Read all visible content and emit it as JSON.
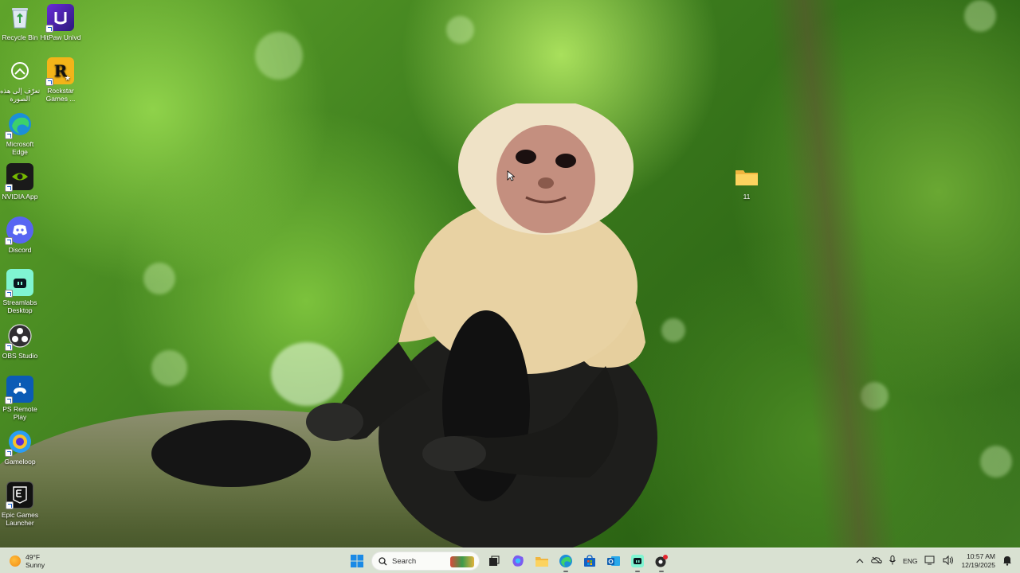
{
  "desktop": {
    "icons": [
      {
        "label": "Recycle Bin",
        "icon": "recycle-bin-icon"
      },
      {
        "label": "HitPaw Univd",
        "icon": "hitpaw-icon"
      },
      {
        "label": "تعرّف إلى هذه الصورة",
        "icon": "learn-about-picture-icon"
      },
      {
        "label": "Rockstar Games ...",
        "icon": "rockstar-icon"
      },
      {
        "label": "Microsoft Edge",
        "icon": "edge-icon"
      },
      {
        "label": "NVIDIA App",
        "icon": "nvidia-icon"
      },
      {
        "label": "Discord",
        "icon": "discord-icon"
      },
      {
        "label": "Streamlabs Desktop",
        "icon": "streamlabs-icon"
      },
      {
        "label": "OBS Studio",
        "icon": "obs-icon"
      },
      {
        "label": "PS Remote Play",
        "icon": "ps-remote-play-icon"
      },
      {
        "label": "Gameloop",
        "icon": "gameloop-icon"
      },
      {
        "label": "Epic Games Launcher",
        "icon": "epic-games-icon"
      },
      {
        "label": "11",
        "icon": "folder-icon"
      }
    ]
  },
  "taskbar": {
    "weather": {
      "temp": "49°F",
      "condition": "Sunny"
    },
    "search_placeholder": "Search",
    "apps": [
      "start-icon",
      "search-icon",
      "task-view-icon",
      "copilot-icon",
      "file-explorer-icon",
      "edge-icon",
      "store-icon",
      "outlook-icon",
      "streamlabs-icon",
      "recording-app-icon"
    ],
    "tray": {
      "language": "ENG",
      "time": "10:57 AM",
      "date": "12/19/2025"
    }
  },
  "colors": {
    "taskbar_bg": "#e8ece2",
    "accent_blue": "#1a73e8"
  }
}
